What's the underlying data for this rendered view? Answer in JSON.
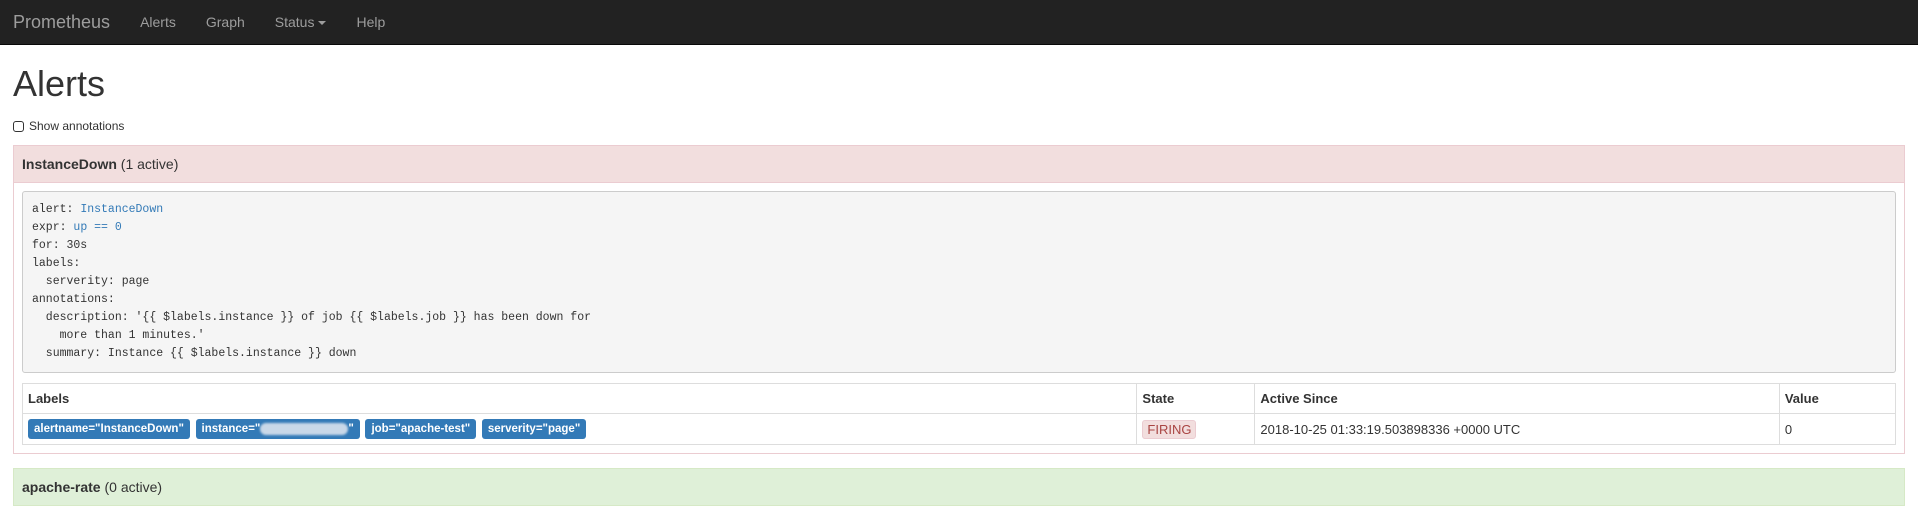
{
  "nav": {
    "brand": "Prometheus",
    "items": [
      {
        "label": "Alerts"
      },
      {
        "label": "Graph"
      },
      {
        "label": "Status"
      },
      {
        "label": "Help"
      }
    ]
  },
  "page": {
    "title": "Alerts",
    "show_annotations_label": "Show annotations"
  },
  "alert_groups": [
    {
      "name": "InstanceDown",
      "active": "(1 active)",
      "rule": {
        "alert_key": "alert: ",
        "alert_val": "InstanceDown",
        "expr_key": "expr: ",
        "expr_val": "up == 0",
        "rest": "for: 30s\nlabels:\n  serverity: page\nannotations:\n  description: '{{ $labels.instance }} of job {{ $labels.job }} has been down for\n    more than 1 minutes.'\n  summary: Instance {{ $labels.instance }} down"
      },
      "table": {
        "headers": [
          "Labels",
          "State",
          "Active Since",
          "Value"
        ],
        "rows": [
          {
            "labels": [
              "alertname=\"InstanceDown\"",
              "instance=\"",
              "job=\"apache-test\"",
              "serverity=\"page\""
            ],
            "instance_suffix": "\"",
            "state": "FIRING",
            "active_since": "2018-10-25 01:33:19.503898336 +0000 UTC",
            "value": "0"
          }
        ]
      }
    },
    {
      "name": "apache-rate",
      "active": "(0 active)"
    }
  ],
  "colors": {
    "navbar": "#222222",
    "firing_bg": "#f2dede",
    "ok_bg": "#dff0d8",
    "label_blue": "#337ab7"
  }
}
